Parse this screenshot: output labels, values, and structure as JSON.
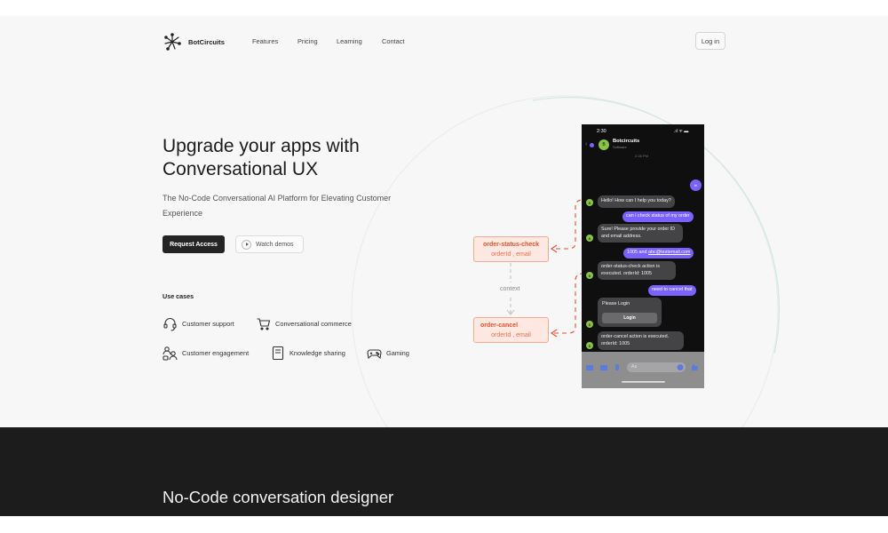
{
  "nav": {
    "brand": "BotCircuits",
    "links": [
      "Features",
      "Pricing",
      "Learning",
      "Contact"
    ],
    "login": "Log in"
  },
  "hero": {
    "title_line1": "Upgrade your apps with",
    "title_line2": "Conversational UX",
    "subtitle": "The No-Code Conversational AI Platform for Elevating Customer Experience",
    "primary_button": "Request Access",
    "secondary_button": "Watch demos"
  },
  "use_cases": {
    "title": "Use cases",
    "items": [
      {
        "label": "Customer support",
        "icon": "headset-icon"
      },
      {
        "label": "Conversational commerce",
        "icon": "cart-icon"
      },
      {
        "label": "Customer engagement",
        "icon": "people-icon"
      },
      {
        "label": "Knowledge sharing",
        "icon": "book-icon"
      },
      {
        "label": "Gaming",
        "icon": "gamepad-icon"
      }
    ]
  },
  "diagram": {
    "action1": {
      "name": "order-status-check",
      "params": "orderId , email"
    },
    "context_label": "context",
    "action2": {
      "name": "order-cancel",
      "params": "orderId , email"
    }
  },
  "phone": {
    "time": "2:30",
    "status": ".ıl ᯤ ▬",
    "contact_name": "Botcircuits",
    "contact_sub": "Software",
    "timestamp": "2:28 PM",
    "user_avatar": "hi",
    "bot_avatar": "B",
    "messages": [
      {
        "from": "bot",
        "text": "Hello! How can I help you today?"
      },
      {
        "from": "user",
        "text": "can i check status of my order"
      },
      {
        "from": "bot",
        "text": "Sure! Please provide your order ID and email address."
      },
      {
        "from": "user",
        "text_pre": "1005 and ",
        "text_link": "abc@testemail.com"
      },
      {
        "from": "bot",
        "text": "order-status-check action is executed. orderId: 1005"
      },
      {
        "from": "user",
        "text": "need to cancel that"
      },
      {
        "from": "bot",
        "text": "Please Login",
        "button": "Login"
      },
      {
        "from": "bot",
        "text": "order-cancel action is executed. orderId: 1005"
      }
    ],
    "input_placeholder": "Aa"
  },
  "section2": {
    "title": "No-Code conversation designer"
  },
  "colors": {
    "accent_purple": "#7b61ff",
    "action_red": "#e0522f",
    "dark_bg": "#1c1c1c"
  }
}
